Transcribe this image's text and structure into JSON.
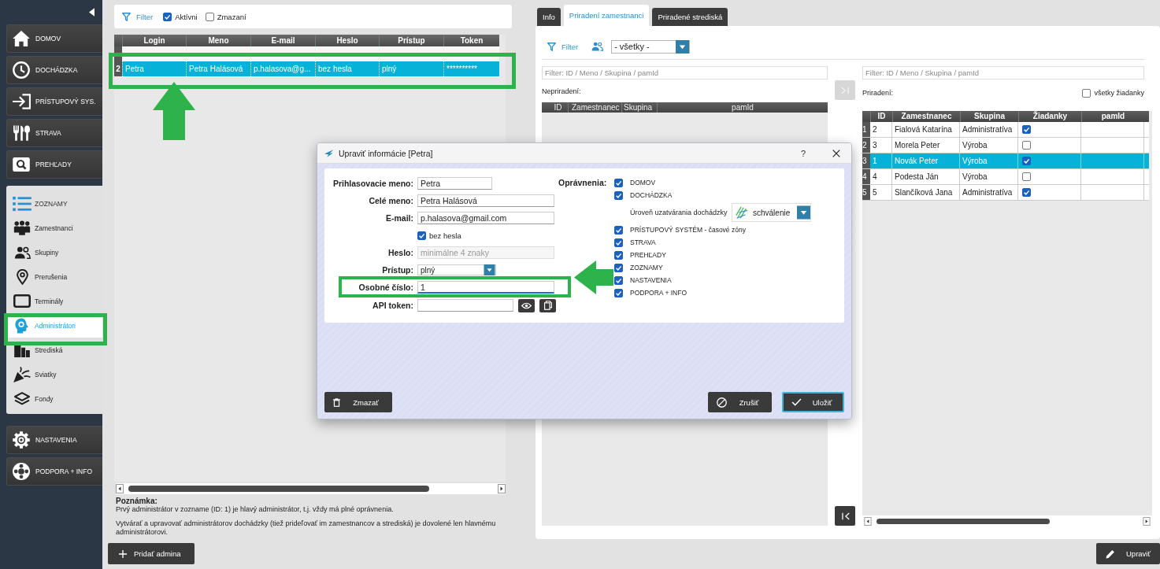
{
  "sidebar": {
    "items": [
      {
        "kind": "button",
        "label": "DOMOV",
        "selected": false
      },
      {
        "kind": "button",
        "label": "DOCHÁDZKA",
        "selected": false
      },
      {
        "kind": "button",
        "label": "PRÍSTUPOVÝ SYS.",
        "selected": false
      },
      {
        "kind": "button",
        "label": "STRAVA",
        "selected": false
      },
      {
        "kind": "button",
        "label": "PREHĽADY",
        "selected": false
      },
      {
        "kind": "group",
        "label": "ZOZNAMY",
        "expanded": true,
        "children": [
          {
            "label": "Zamestnanci",
            "selected": false
          },
          {
            "label": "Skupiny",
            "selected": false
          },
          {
            "label": "Prerušenia",
            "selected": false
          },
          {
            "label": "Terminály",
            "selected": false
          },
          {
            "label": "Administrátori",
            "selected": true
          },
          {
            "label": "Strediská",
            "selected": false
          },
          {
            "label": "Sviatky",
            "selected": false
          },
          {
            "label": "Fondy",
            "selected": false
          }
        ]
      },
      {
        "kind": "button",
        "label": "NASTAVENIA",
        "selected": false
      },
      {
        "kind": "button",
        "label": "PODPORA + INFO",
        "selected": false
      }
    ]
  },
  "admins": {
    "filter": {
      "label": "Filter",
      "options": [
        {
          "label": "Aktívni",
          "checked": true
        },
        {
          "label": "Zmazaní",
          "checked": false
        }
      ]
    },
    "table": {
      "columns": [
        "Login",
        "Meno",
        "E-mail",
        "Heslo",
        "Prístup",
        "Token"
      ],
      "rows": [
        {
          "selected": false
        },
        {
          "number": "2",
          "selected": true,
          "cells": [
            "Petra",
            "Petra Halásová",
            "p.halasova@g...",
            "bez hesla",
            "plný",
            "**********"
          ]
        }
      ]
    },
    "note": {
      "title": "Poznámka:",
      "paragraphs": [
        "Prvý administrátor v zozname (ID: 1) je hlavý administrátor, t.j. vždy má plné oprávnenia.",
        "Vytvárať a upravovať administrátorov dochádzky (tiež prideľovať im zamestnancov a strediská) je dovolené len hlavnému administrátorovi."
      ]
    },
    "add_button": "Pridať admina"
  },
  "detail": {
    "tabs": [
      {
        "label": "Info",
        "selected": false
      },
      {
        "label": "Priradení zamestnanci",
        "selected": true
      },
      {
        "label": "Priradené strediská",
        "selected": false
      }
    ],
    "filter": {
      "label": "Filter",
      "group": "- všetky -"
    },
    "unassigned": {
      "search_placeholder": "Filter: ID / Meno / Skupina / pamId",
      "title": "Nepriradení:",
      "columns": [
        "ID",
        "Zamestnanec",
        "Skupina",
        "pamId"
      ]
    },
    "assign_button": {
      "disabled": true
    },
    "unassign_button": {
      "disabled": false
    },
    "assigned": {
      "search_placeholder": "Filter: ID / Meno / Skupina / pamId",
      "title": "Priradení:",
      "all_requests": {
        "label": "všetky žiadanky",
        "checked": false
      },
      "columns": [
        "ID",
        "Zamestnanec",
        "Skupina",
        "Žiadanky",
        "pamId"
      ],
      "rows": [
        {
          "number": "1",
          "cells": [
            "2",
            "Fialová Katarína",
            "Administratíva"
          ],
          "requests": true,
          "selected": false
        },
        {
          "number": "2",
          "cells": [
            "3",
            "Morela Peter",
            "Výroba"
          ],
          "requests": false,
          "selected": false
        },
        {
          "number": "3",
          "cells": [
            "1",
            "Novák Peter",
            "Výroba"
          ],
          "requests": true,
          "selected": true
        },
        {
          "number": "4",
          "cells": [
            "4",
            "Podesta Ján",
            "Výroba"
          ],
          "requests": false,
          "selected": false
        },
        {
          "number": "5",
          "cells": [
            "5",
            "Slančíková Jana",
            "Administratíva"
          ],
          "requests": true,
          "selected": false
        }
      ]
    },
    "edit_button": "Upraviť"
  },
  "dialog": {
    "title": "Upraviť informácie [Petra]",
    "help": "?",
    "fields": [
      {
        "kind": "text",
        "label": "Prihlasovacie meno:",
        "value": "Petra",
        "focused": false,
        "disabled": false
      },
      {
        "kind": "text",
        "label": "Celé meno:",
        "value": "Petra Halásová",
        "focused": false,
        "disabled": false
      },
      {
        "kind": "text",
        "label": "E-mail:",
        "value": "p.halasova@gmail.com",
        "focused": false,
        "disabled": false
      },
      {
        "kind": "checkbox",
        "label": "bez hesla",
        "checked": true
      },
      {
        "kind": "text",
        "label": "Heslo:",
        "placeholder": "minimálne 4 znaky",
        "focused": false,
        "disabled": true
      },
      {
        "kind": "select",
        "label": "Prístup:",
        "value": "plný"
      },
      {
        "kind": "text",
        "label": "Osobné číslo:",
        "value": "1",
        "focused": true,
        "disabled": false
      },
      {
        "kind": "token",
        "label": "API token:"
      }
    ],
    "permissions": {
      "label": "Oprávnenia:",
      "items": [
        {
          "kind": "check",
          "label": "DOMOV",
          "checked": true
        },
        {
          "kind": "check",
          "label": "DOCHÁDZKA",
          "checked": true
        },
        {
          "kind": "select",
          "label": "Úroveň uzatvárania dochádzky",
          "value": "schválenie"
        },
        {
          "kind": "check",
          "label": "PRÍSTUPOVÝ SYSTÉM - časové zóny",
          "checked": true
        },
        {
          "kind": "check",
          "label": "STRAVA",
          "checked": true
        },
        {
          "kind": "check",
          "label": "PREHĽADY",
          "checked": true
        },
        {
          "kind": "check",
          "label": "ZOZNAMY",
          "checked": true
        },
        {
          "kind": "check",
          "label": "NASTAVENIA",
          "checked": true
        },
        {
          "kind": "check",
          "label": "PODPORA + INFO",
          "checked": true
        }
      ]
    },
    "buttons": [
      {
        "kind": "delete",
        "label": "Zmazať",
        "focused": false
      },
      {
        "kind": "cancel",
        "label": "Zrušiť",
        "focused": false
      },
      {
        "kind": "save",
        "label": "Uložiť",
        "focused": true
      }
    ]
  }
}
